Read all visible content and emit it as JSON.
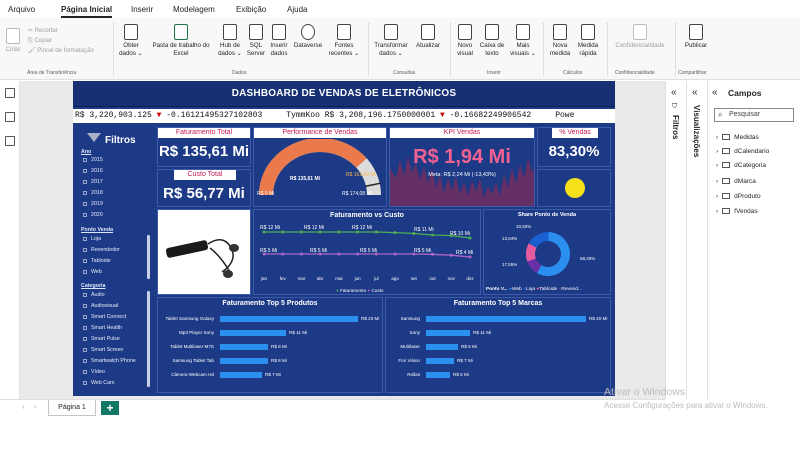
{
  "menu": {
    "items": [
      "Arquivo",
      "Página Inicial",
      "Inserir",
      "Modelagem",
      "Exibição",
      "Ajuda"
    ]
  },
  "ribbon": {
    "clipboard": [
      "Recortar",
      "Copiar",
      "Pincel de formatação"
    ],
    "colar": "Colar",
    "buttons": [
      {
        "id": "obter-dados",
        "line1": "Obter",
        "line2": "dados ⌄"
      },
      {
        "id": "pasta-excel",
        "line1": "Pasta de trabalho do",
        "line2": "Excel"
      },
      {
        "id": "hub",
        "line1": "Hub de",
        "line2": "dados ⌄"
      },
      {
        "id": "sql",
        "line1": "SQL",
        "line2": "Server"
      },
      {
        "id": "inserir-dados",
        "line1": "Inserir",
        "line2": "dados"
      },
      {
        "id": "dataverse",
        "line1": "Dataverse",
        "line2": ""
      },
      {
        "id": "fontes",
        "line1": "Fontes",
        "line2": "recentes ⌄"
      },
      {
        "id": "transformar",
        "line1": "Transformar",
        "line2": "dados ⌄"
      },
      {
        "id": "atualizar",
        "line1": "Atualizar",
        "line2": ""
      },
      {
        "id": "novo-visual",
        "line1": "Novo",
        "line2": "visual"
      },
      {
        "id": "caixa-texto",
        "line1": "Caixa de",
        "line2": "texto"
      },
      {
        "id": "mais-visuais",
        "line1": "Mais",
        "line2": "visuais ⌄"
      },
      {
        "id": "nova-medida",
        "line1": "Nova",
        "line2": "medida"
      },
      {
        "id": "medida-rapida",
        "line1": "Medida",
        "line2": "rápida"
      },
      {
        "id": "confidencialidade",
        "line1": "Confidencialidade",
        "line2": ""
      },
      {
        "id": "publicar",
        "line1": "Publicar",
        "line2": ""
      }
    ],
    "groups": [
      "Área de Transferência",
      "Dados",
      "Consultas",
      "Inserir",
      "Cálculos",
      "Confidencialidade",
      "Compartilhar"
    ]
  },
  "dashboard": {
    "title": "DASHBOARD DE VENDAS DE ELETRÔNICOS",
    "ticker": {
      "a": "R$ 3,220,903.125",
      "a_delta": "-0.16121495327102803",
      "name": "TymmKoo",
      "b": "R$ 3,208,196.1750000001",
      "b_delta": "-0.16682249906542",
      "tail": "Powe"
    },
    "filters": {
      "title": "Filtros",
      "ano_label": "Ano",
      "anos": [
        "2015",
        "2016",
        "2017",
        "2018",
        "2019",
        "2020"
      ],
      "ponto_label": "Ponto Venda",
      "pontos": [
        "Loja",
        "Revendedor",
        "Tabloide",
        "Web"
      ],
      "categoria_label": "Categoria",
      "categorias": [
        "Áudio",
        "Audiovisual",
        "Smart Connect",
        "Smart Health",
        "Smart Pulse",
        "Smart Screen",
        "Smartwatch Phone",
        "Vídeo",
        "Web Cam"
      ]
    },
    "faturamento_total": {
      "label": "Faturamento Total",
      "value": "R$ 135,61 Mi"
    },
    "custo_total": {
      "label": "Custo Total",
      "value": "R$ 56,77 Mi"
    },
    "performance": {
      "label": "Performance de Vendas",
      "min": "R$ 0 Mi",
      "max": "R$ 174,08 Mi",
      "value": "R$ 135,61 Mi",
      "target": "R$ 162,69 Mi",
      "fraction": 0.779
    },
    "kpi": {
      "label": "KPI Vendas",
      "value": "R$ 1,94 Mi",
      "meta": "Meta: R$ 2,24 Mi (-13,43%)"
    },
    "pct_vendas": {
      "label": "% Vendas",
      "value": "83,30%"
    },
    "fat_custo": {
      "title": "Faturamento vs Custo",
      "legend": [
        "Faturamento",
        "Custo"
      ],
      "months": [
        "jan",
        "fev",
        "mar",
        "abr",
        "mai",
        "jun",
        "jul",
        "ago",
        "set",
        "out",
        "nov",
        "dez"
      ],
      "fat_labels": [
        "R$ 12 Mi",
        "R$ 12 Mi",
        "R$ 12 Mi",
        "R$ 11 Mi",
        "R$ 10 Mi"
      ],
      "custo_labels": [
        "R$ 5 Mi",
        "R$ 5 Mi",
        "R$ 5 Mi",
        "R$ 5 Mi",
        "R$ 4 Mi"
      ]
    },
    "share": {
      "title": "Share Ponto de Venda",
      "pcts": [
        "10,93%",
        "13,64%",
        "17,55%",
        "58,46%"
      ],
      "legend_label": "Ponto V...",
      "legend": [
        "Web",
        "Loja",
        "Tabloide",
        "Revend..."
      ]
    },
    "top_produtos": {
      "title": "Faturamento Top 5 Produtos",
      "items": [
        {
          "name": "Tablet Samsung Galaxy",
          "val": "R$ 23 Mi",
          "num": 23
        },
        {
          "name": "Mp3 Player Sony",
          "val": "R$ 11 Mi",
          "num": 11
        },
        {
          "name": "Tablet Multilaser M7S",
          "val": "R$ 8 Mi",
          "num": 8
        },
        {
          "name": "Samsung Tablet Tab",
          "val": "R$ 8 Mi",
          "num": 8
        },
        {
          "name": "Câmera Webcam Hd",
          "val": "R$ 7 Mi",
          "num": 7
        }
      ]
    },
    "top_marcas": {
      "title": "Faturamento Top 5 Marcas",
      "items": [
        {
          "name": "Samsung",
          "val": "R$ 40 Mi",
          "num": 40
        },
        {
          "name": "Sony",
          "val": "R$ 11 Mi",
          "num": 11
        },
        {
          "name": "Multilaser",
          "val": "R$ 8 Mi",
          "num": 8
        },
        {
          "name": "Fon Vision",
          "val": "R$ 7 Mi",
          "num": 7
        },
        {
          "name": "Rollas",
          "val": "R$ 6 Mi",
          "num": 6
        }
      ]
    }
  },
  "pages": {
    "tab": "Página 1",
    "add": "+"
  },
  "watermark": {
    "line1": "Ativar o Windows",
    "line2": "Acesse Configurações para ativar o Windows."
  },
  "panes": {
    "filtros": "Filtros",
    "visualizacoes": "Visualizações",
    "campos": "Campos",
    "search_placeholder": "Pesquisar",
    "fields": [
      "Medidas",
      "dCalendario",
      "dCategoria",
      "dMarca",
      "dProduto",
      "fVendas"
    ]
  },
  "colors": {
    "dash_bg": "#1d3a86",
    "accent": "#2b8ff0",
    "gauge": "#ea7a4b",
    "kpi": "#e8506e",
    "faturamento": "#4caf50",
    "custo": "#b066c9",
    "yellow": "#f5e11a"
  }
}
